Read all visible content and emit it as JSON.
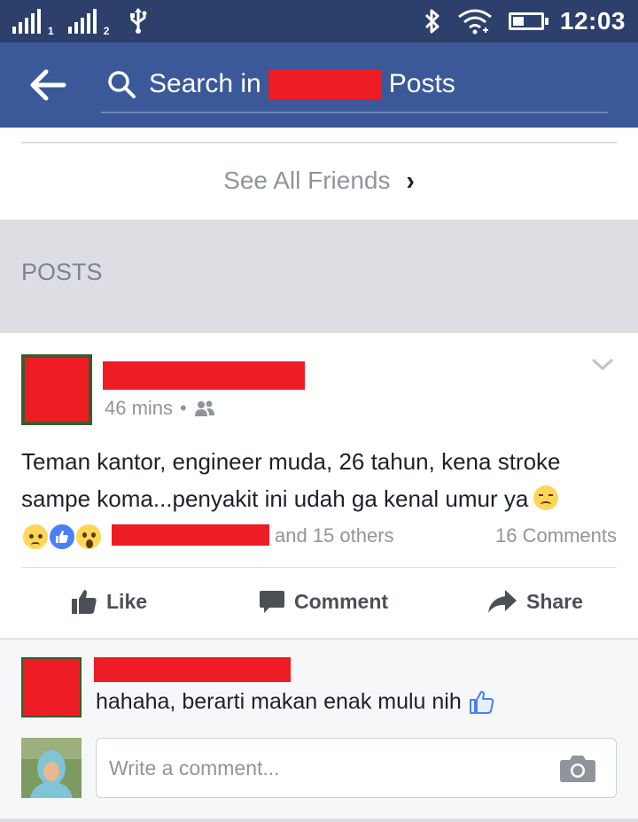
{
  "status_bar": {
    "sim1": "1",
    "sim2": "2",
    "time": "12:03",
    "icons": [
      "signal-icon",
      "usb-icon",
      "bluetooth-icon",
      "wifi-icon",
      "battery-icon"
    ]
  },
  "app_bar": {
    "search_prefix": "Search in",
    "search_suffix": "Posts"
  },
  "friends": {
    "see_all_label": "See All Friends",
    "chevron": "›"
  },
  "posts_section": {
    "header": "POSTS"
  },
  "post": {
    "time": "46 mins",
    "separator": "•",
    "text": "Teman kantor, engineer muda, 26 tahun, kena stroke sampe koma...penyakit ini udah ga kenal umur ya",
    "reactions": [
      "sad",
      "like",
      "wow"
    ],
    "others_label": "and 15 others",
    "comments_count": "16 Comments",
    "actions": {
      "like": "Like",
      "comment": "Comment",
      "share": "Share"
    }
  },
  "comment": {
    "text": "hahaha, berarti makan enak mulu nih"
  },
  "write_comment": {
    "placeholder": "Write a comment..."
  },
  "colors": {
    "status_bar": "#2d3f6b",
    "app_bar": "#3b5998",
    "redaction": "#ee1c25",
    "like_blue": "#4a7ff5"
  }
}
